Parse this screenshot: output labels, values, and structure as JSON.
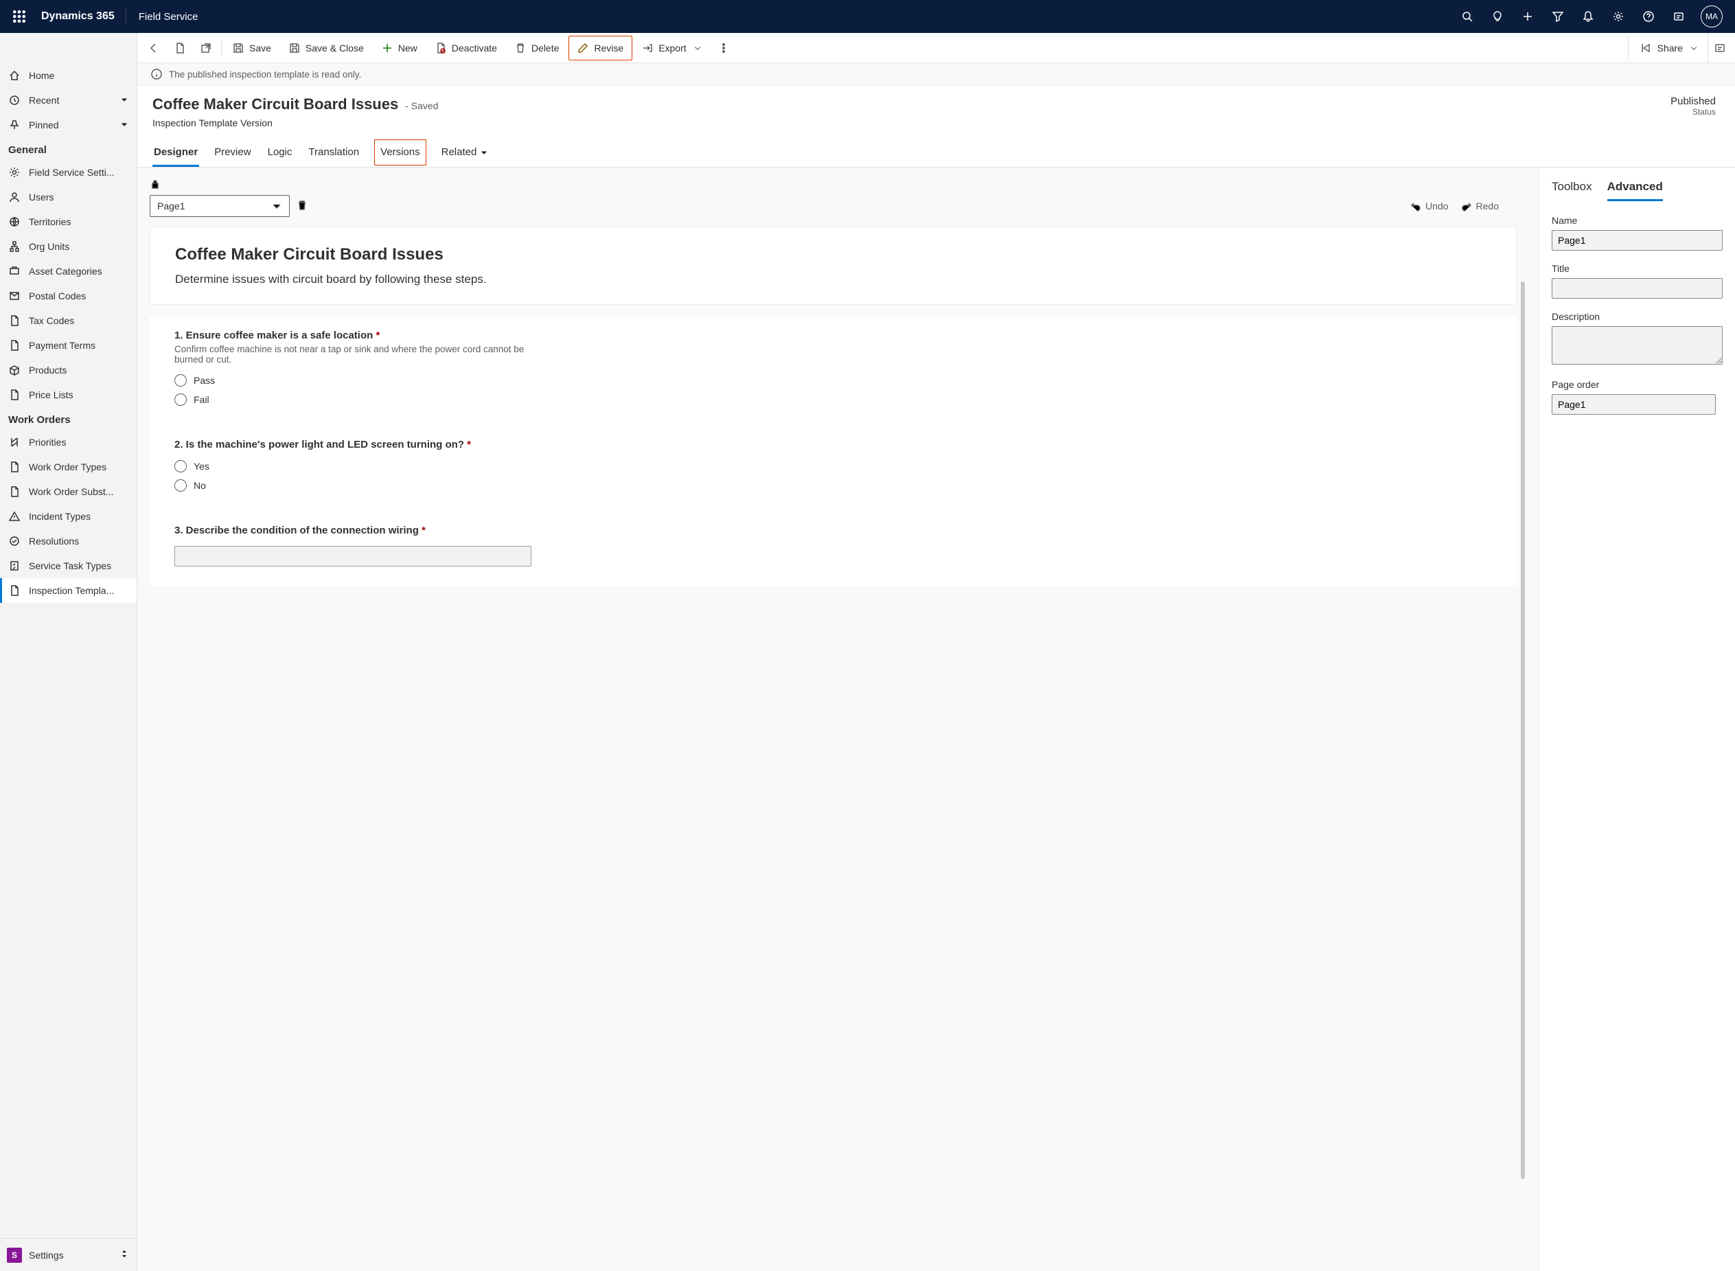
{
  "topbar": {
    "brand": "Dynamics 365",
    "appname": "Field Service",
    "avatar_initials": "MA"
  },
  "nav": {
    "top": [
      {
        "label": "Home",
        "icon": "home"
      },
      {
        "label": "Recent",
        "icon": "clock",
        "expandable": true
      },
      {
        "label": "Pinned",
        "icon": "pin",
        "expandable": true
      }
    ],
    "groups": [
      {
        "title": "General",
        "items": [
          {
            "label": "Field Service Setti...",
            "icon": "gear"
          },
          {
            "label": "Users",
            "icon": "person"
          },
          {
            "label": "Territories",
            "icon": "globe"
          },
          {
            "label": "Org Units",
            "icon": "org"
          },
          {
            "label": "Asset Categories",
            "icon": "asset"
          },
          {
            "label": "Postal Codes",
            "icon": "postal"
          },
          {
            "label": "Tax Codes",
            "icon": "doc"
          },
          {
            "label": "Payment Terms",
            "icon": "doc"
          },
          {
            "label": "Products",
            "icon": "box"
          },
          {
            "label": "Price Lists",
            "icon": "doc"
          }
        ]
      },
      {
        "title": "Work Orders",
        "items": [
          {
            "label": "Priorities",
            "icon": "priority"
          },
          {
            "label": "Work Order Types",
            "icon": "doc"
          },
          {
            "label": "Work Order Subst...",
            "icon": "doc"
          },
          {
            "label": "Incident Types",
            "icon": "warning"
          },
          {
            "label": "Resolutions",
            "icon": "check"
          },
          {
            "label": "Service Task Types",
            "icon": "task"
          },
          {
            "label": "Inspection Templa...",
            "icon": "doc",
            "selected": true
          }
        ]
      }
    ],
    "area": {
      "badge": "S",
      "label": "Settings"
    }
  },
  "cmdbar": {
    "save": "Save",
    "save_close": "Save & Close",
    "new": "New",
    "deactivate": "Deactivate",
    "delete": "Delete",
    "revise": "Revise",
    "export": "Export",
    "share": "Share"
  },
  "infobar": {
    "message": "The published inspection template is read only."
  },
  "record": {
    "title": "Coffee Maker Circuit Board Issues",
    "saved_suffix": "- Saved",
    "subtitle": "Inspection Template Version",
    "status_value": "Published",
    "status_label": "Status"
  },
  "tabs": {
    "items": [
      "Designer",
      "Preview",
      "Logic",
      "Translation",
      "Versions",
      "Related"
    ],
    "active": "Designer",
    "highlighted": "Versions"
  },
  "designer": {
    "page_selector": "Page1",
    "undo": "Undo",
    "redo": "Redo",
    "canvas": {
      "title": "Coffee Maker Circuit Board Issues",
      "description": "Determine issues with circuit board by following these steps."
    },
    "questions": [
      {
        "num": "1.",
        "title": "Ensure coffee maker is a safe location",
        "required": true,
        "help": "Confirm coffee machine is not near a tap or sink and where the power cord cannot be burned or cut.",
        "options": [
          "Pass",
          "Fail"
        ]
      },
      {
        "num": "2.",
        "title": "Is the machine's power light and LED screen turning on?",
        "required": true,
        "options": [
          "Yes",
          "No"
        ]
      },
      {
        "num": "3.",
        "title": "Describe the condition of the connection wiring",
        "required": true,
        "type": "text"
      }
    ]
  },
  "panel": {
    "tabs": {
      "toolbox": "Toolbox",
      "advanced": "Advanced",
      "active": "Advanced"
    },
    "fields": {
      "name_label": "Name",
      "name_value": "Page1",
      "title_label": "Title",
      "title_value": "",
      "description_label": "Description",
      "description_value": "",
      "page_order_label": "Page order",
      "page_order_value": "Page1"
    }
  }
}
